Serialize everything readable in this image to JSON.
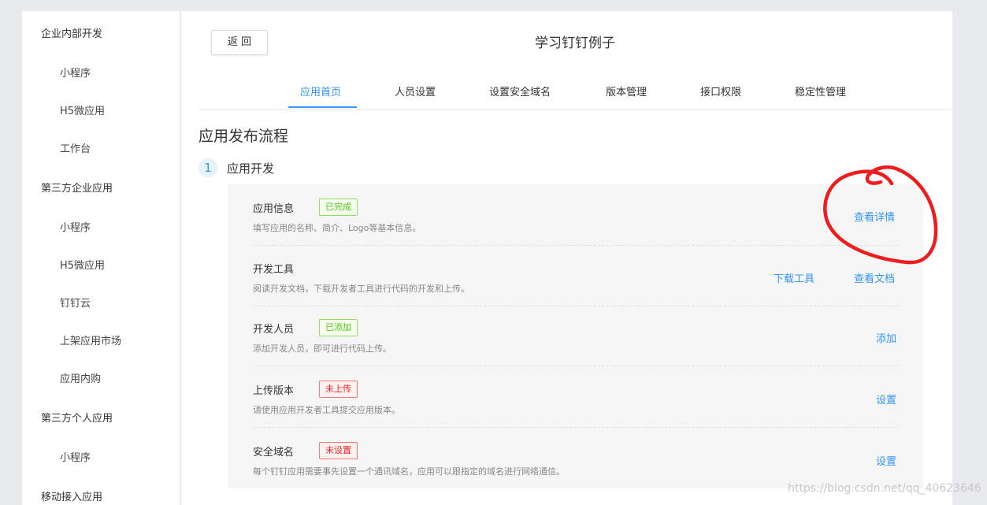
{
  "sidebar": {
    "items": [
      {
        "label": "企业内部开发",
        "type": "group"
      },
      {
        "label": "小程序",
        "type": "sub"
      },
      {
        "label": "H5微应用",
        "type": "sub"
      },
      {
        "label": "工作台",
        "type": "sub"
      },
      {
        "label": "第三方企业应用",
        "type": "group"
      },
      {
        "label": "小程序",
        "type": "sub"
      },
      {
        "label": "H5微应用",
        "type": "sub"
      },
      {
        "label": "钉钉云",
        "type": "sub"
      },
      {
        "label": "上架应用市场",
        "type": "sub"
      },
      {
        "label": "应用内购",
        "type": "sub"
      },
      {
        "label": "第三方个人应用",
        "type": "group"
      },
      {
        "label": "小程序",
        "type": "sub"
      },
      {
        "label": "移动接入应用",
        "type": "group"
      }
    ]
  },
  "header": {
    "back_label": "返 回",
    "app_title": "学习钉钉例子"
  },
  "tabs": [
    {
      "label": "应用首页",
      "active": true
    },
    {
      "label": "人员设置",
      "active": false
    },
    {
      "label": "设置安全域名",
      "active": false
    },
    {
      "label": "版本管理",
      "active": false
    },
    {
      "label": "接口权限",
      "active": false
    },
    {
      "label": "稳定性管理",
      "active": false
    }
  ],
  "main": {
    "section_title": "应用发布流程",
    "step_number": "1",
    "step_label": "应用开发",
    "rows": [
      {
        "title": "应用信息",
        "badge": "已完成",
        "badge_color": "green",
        "desc": "填写应用的名称、简介、Logo等基本信息。",
        "actions": [
          "查看详情"
        ]
      },
      {
        "title": "开发工具",
        "badge": "",
        "badge_color": "",
        "desc": "阅读开发文档，下载开发者工具进行代码的开发和上传。",
        "actions": [
          "下载工具",
          "查看文档"
        ]
      },
      {
        "title": "开发人员",
        "badge": "已添加",
        "badge_color": "green",
        "desc": "添加开发人员，即可进行代码上传。",
        "actions": [
          "添加"
        ]
      },
      {
        "title": "上传版本",
        "badge": "未上传",
        "badge_color": "red",
        "desc": "请使用应用开发者工具提交应用版本。",
        "actions": [
          "设置"
        ]
      },
      {
        "title": "安全域名",
        "badge": "未设置",
        "badge_color": "red",
        "desc": "每个钉钉应用需要事先设置一个通讯域名，应用可以跟指定的域名进行网络通信。",
        "actions": [
          "设置"
        ]
      }
    ]
  },
  "watermark": "https://blog.csdn.net/qq_40623646",
  "colors": {
    "accent": "#3296fa",
    "annotation": "#ee1c1c",
    "badge_green": "#52c41a",
    "badge_red": "#f5222d"
  }
}
